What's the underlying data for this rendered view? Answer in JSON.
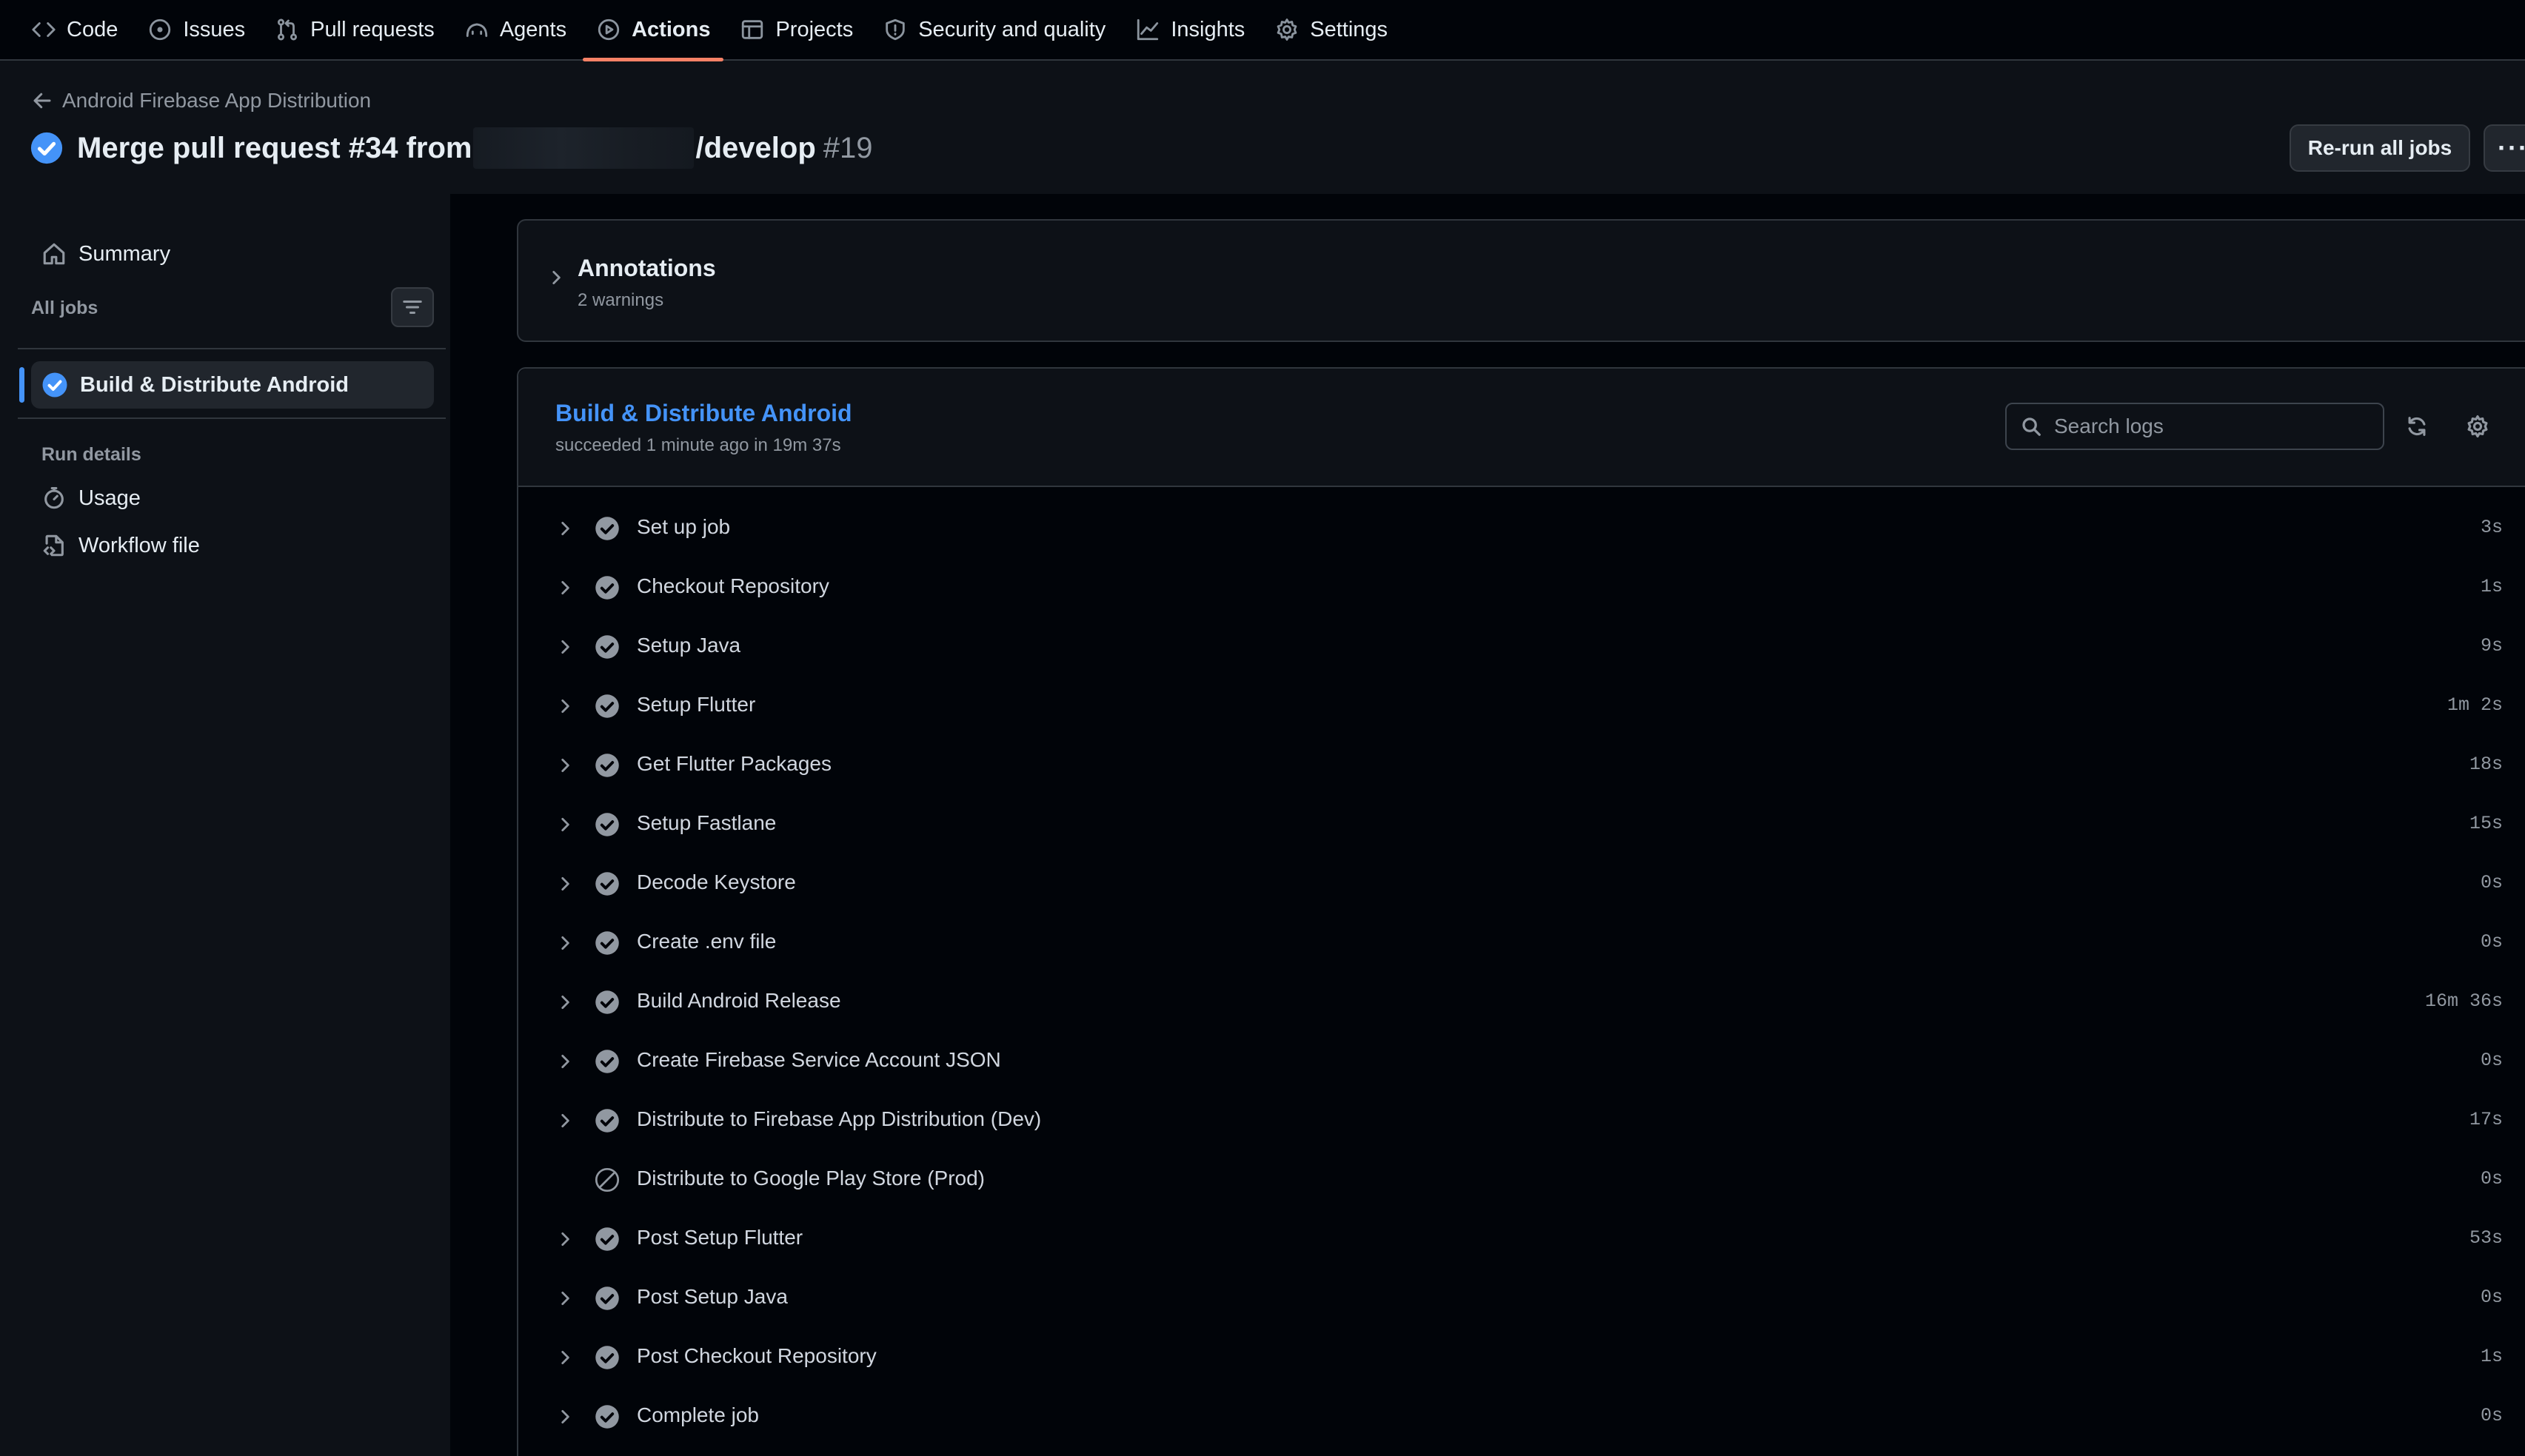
{
  "nav": {
    "items": [
      {
        "label": "Code",
        "icon": "code-icon",
        "active": false
      },
      {
        "label": "Issues",
        "icon": "issue-icon",
        "active": false
      },
      {
        "label": "Pull requests",
        "icon": "pull-request-icon",
        "active": false
      },
      {
        "label": "Agents",
        "icon": "agent-icon",
        "active": false
      },
      {
        "label": "Actions",
        "icon": "play-icon",
        "active": true
      },
      {
        "label": "Projects",
        "icon": "table-icon",
        "active": false
      },
      {
        "label": "Security and quality",
        "icon": "shield-icon",
        "active": false
      },
      {
        "label": "Insights",
        "icon": "graph-icon",
        "active": false
      },
      {
        "label": "Settings",
        "icon": "gear-icon",
        "active": false
      }
    ],
    "active_underline_color": "#f78166"
  },
  "header": {
    "workflow_name": "Android Firebase App Distribution",
    "title_prefix": "Merge pull request #34 from",
    "title_suffix": "/develop",
    "run_number": "#19",
    "rerun_label": "Re-run all jobs",
    "more_label": "···"
  },
  "sidebar": {
    "summary_label": "Summary",
    "all_jobs_label": "All jobs",
    "job_label": "Build & Distribute Android",
    "run_details_label": "Run details",
    "usage_label": "Usage",
    "workflow_file_label": "Workflow file"
  },
  "annotations": {
    "title": "Annotations",
    "subtitle": "2 warnings"
  },
  "job": {
    "title": "Build & Distribute Android",
    "subtitle": "succeeded 1 minute ago in 19m 37s",
    "search_placeholder": "Search logs",
    "accent_color": "#4493f8",
    "steps": [
      {
        "name": "Set up job",
        "duration": "3s",
        "status": "success",
        "expandable": true
      },
      {
        "name": "Checkout Repository",
        "duration": "1s",
        "status": "success",
        "expandable": true
      },
      {
        "name": "Setup Java",
        "duration": "9s",
        "status": "success",
        "expandable": true
      },
      {
        "name": "Setup Flutter",
        "duration": "1m 2s",
        "status": "success",
        "expandable": true
      },
      {
        "name": "Get Flutter Packages",
        "duration": "18s",
        "status": "success",
        "expandable": true
      },
      {
        "name": "Setup Fastlane",
        "duration": "15s",
        "status": "success",
        "expandable": true
      },
      {
        "name": "Decode Keystore",
        "duration": "0s",
        "status": "success",
        "expandable": true
      },
      {
        "name": "Create .env file",
        "duration": "0s",
        "status": "success",
        "expandable": true
      },
      {
        "name": "Build Android Release",
        "duration": "16m 36s",
        "status": "success",
        "expandable": true
      },
      {
        "name": "Create Firebase Service Account JSON",
        "duration": "0s",
        "status": "success",
        "expandable": true
      },
      {
        "name": "Distribute to Firebase App Distribution (Dev)",
        "duration": "17s",
        "status": "success",
        "expandable": true
      },
      {
        "name": "Distribute to Google Play Store (Prod)",
        "duration": "0s",
        "status": "skipped",
        "expandable": false
      },
      {
        "name": "Post Setup Flutter",
        "duration": "53s",
        "status": "success",
        "expandable": true
      },
      {
        "name": "Post Setup Java",
        "duration": "0s",
        "status": "success",
        "expandable": true
      },
      {
        "name": "Post Checkout Repository",
        "duration": "1s",
        "status": "success",
        "expandable": true
      },
      {
        "name": "Complete job",
        "duration": "0s",
        "status": "success",
        "expandable": true
      }
    ]
  }
}
